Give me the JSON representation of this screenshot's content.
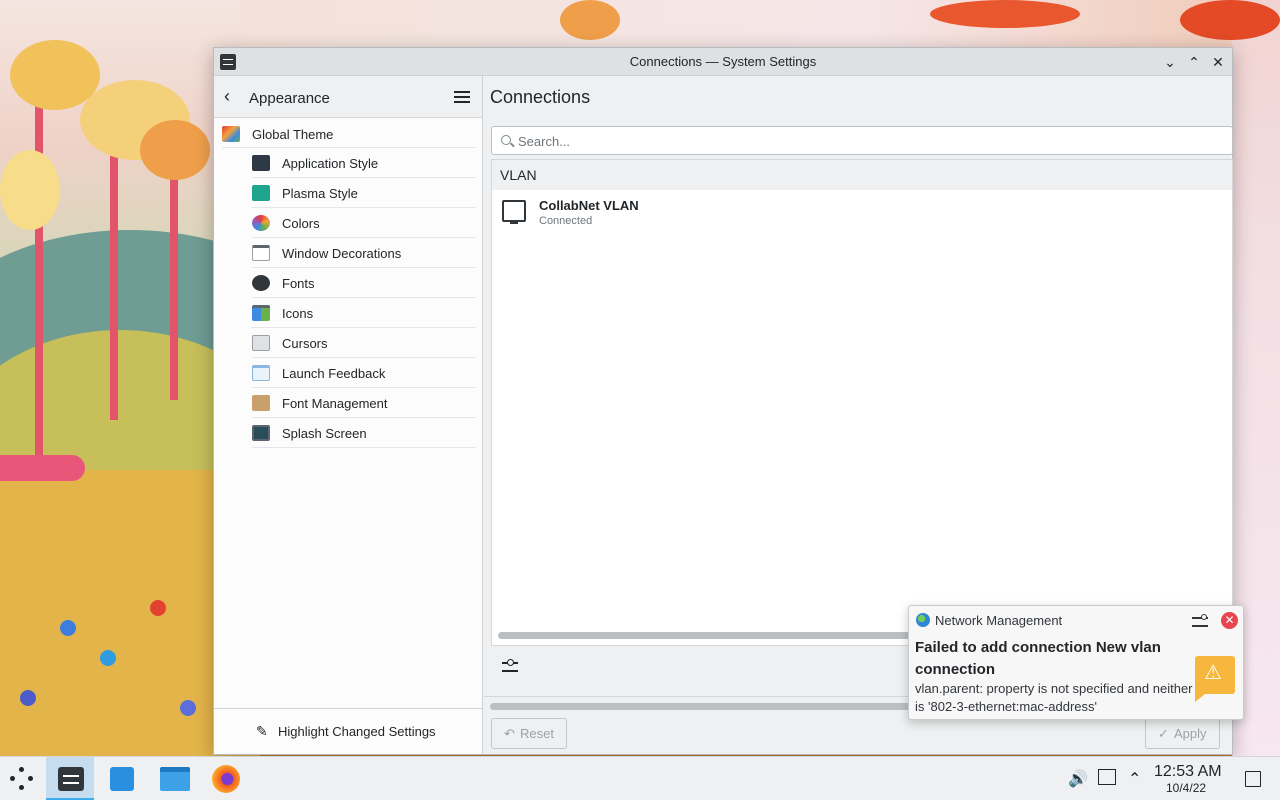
{
  "window": {
    "title": "Connections — System Settings"
  },
  "sidebar": {
    "header_title": "Appearance",
    "category_label": "Global Theme",
    "items": [
      {
        "label": "Application Style",
        "icon": "application-style-icon",
        "color": "#2d3a45"
      },
      {
        "label": "Plasma Style",
        "icon": "plasma-style-icon",
        "color": "#1fa58d"
      },
      {
        "label": "Colors",
        "icon": "colors-icon",
        "color": "#d8513a"
      },
      {
        "label": "Window Decorations",
        "icon": "window-decorations-icon",
        "color": "#cfd8e0"
      },
      {
        "label": "Fonts",
        "icon": "fonts-icon",
        "color": "#31363b"
      },
      {
        "label": "Icons",
        "icon": "icons-icon",
        "color": "#3c8ae2"
      },
      {
        "label": "Cursors",
        "icon": "cursors-icon",
        "color": "#9aa0a6"
      },
      {
        "label": "Launch Feedback",
        "icon": "launch-feedback-icon",
        "color": "#8ab6e0"
      },
      {
        "label": "Font Management",
        "icon": "font-management-icon",
        "color": "#c9a06a"
      },
      {
        "label": "Splash Screen",
        "icon": "splash-screen-icon",
        "color": "#2a4d5a"
      }
    ],
    "footer_label": "Highlight Changed Settings"
  },
  "main": {
    "page_title": "Connections",
    "search_placeholder": "Search...",
    "group_header": "VLAN",
    "connection": {
      "name": "CollabNet VLAN",
      "status": "Connected"
    },
    "reset_label": "Reset",
    "apply_label": "Apply"
  },
  "notification": {
    "app_name": "Network Management",
    "title": "Failed to add connection New vlan connection",
    "body": "vlan.parent: property is not specified and neither is '802-3-ethernet:mac-address'",
    "accent": "#f6b73c"
  },
  "taskbar": {
    "time": "12:53 AM",
    "date": "10/4/22"
  }
}
